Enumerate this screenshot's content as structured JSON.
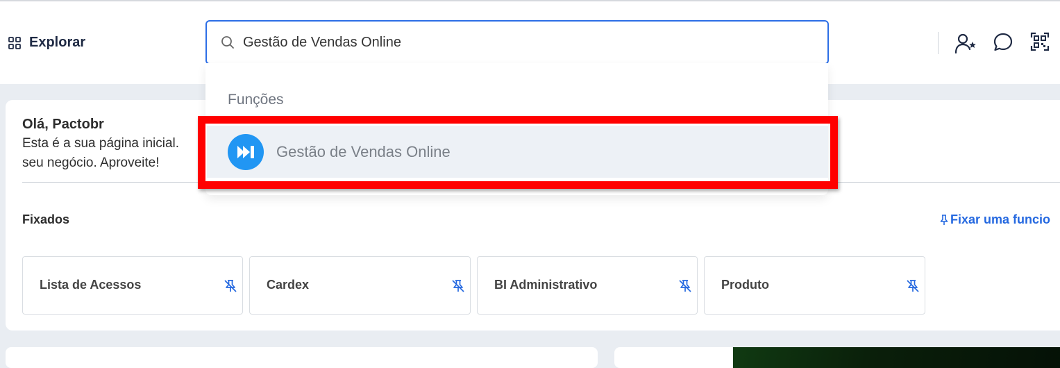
{
  "header": {
    "explore_label": "Explorar",
    "search": {
      "value": "Gestão de Vendas Online",
      "placeholder": ""
    },
    "icons": [
      "add-favorite-user-icon",
      "chat-bubble-icon",
      "qr-code-icon"
    ]
  },
  "search_dropdown": {
    "section_title": "Funções",
    "results": [
      {
        "label": "Gestão de Vendas Online",
        "icon": "fast-forward-circle-icon",
        "icon_color": "#2196f3"
      }
    ]
  },
  "welcome": {
    "title": "Olá, Pactobr",
    "line1": "Esta é a sua página inicial.",
    "line2": "seu negócio. Aproveite!"
  },
  "pinned": {
    "title": "Fixados",
    "pin_link": "Fixar uma funcio",
    "items": [
      {
        "label": "Lista de Acessos"
      },
      {
        "label": "Cardex"
      },
      {
        "label": "BI Administrativo"
      },
      {
        "label": "Produto"
      }
    ]
  },
  "colors": {
    "accent": "#2c6ee6",
    "link": "#2468e0",
    "annotation_highlight": "#ff0000",
    "page_background": "#e9edf2"
  }
}
